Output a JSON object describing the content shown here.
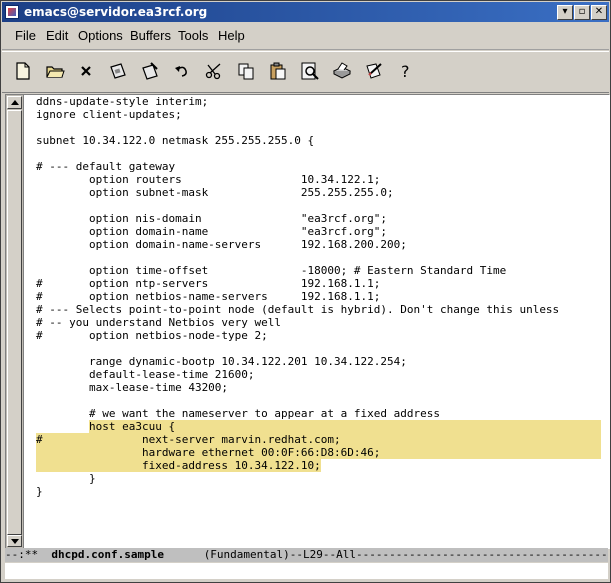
{
  "window": {
    "title": "emacs@servidor.ea3rcf.org",
    "buttons": [
      "▾",
      "▫",
      "✕"
    ]
  },
  "menu": [
    "File",
    "Edit",
    "Options",
    "Buffers",
    "Tools",
    "Help"
  ],
  "toolbar": [
    {
      "name": "new-file-icon"
    },
    {
      "name": "open-folder-icon"
    },
    {
      "name": "close-buffer-icon"
    },
    {
      "name": "save-icon"
    },
    {
      "name": "save-as-icon"
    },
    {
      "name": "undo-icon"
    },
    {
      "name": "cut-icon"
    },
    {
      "name": "copy-icon"
    },
    {
      "name": "paste-icon"
    },
    {
      "name": "search-icon"
    },
    {
      "name": "print-icon"
    },
    {
      "name": "preferences-icon"
    },
    {
      "name": "help-icon"
    }
  ],
  "buffer": {
    "lines": [
      "ddns-update-style interim;",
      "ignore client-updates;",
      "",
      "subnet 10.34.122.0 netmask 255.255.255.0 {",
      "",
      "# --- default gateway",
      "        option routers                  10.34.122.1;",
      "        option subnet-mask              255.255.255.0;",
      "",
      "        option nis-domain               \"ea3rcf.org\";",
      "        option domain-name              \"ea3rcf.org\";",
      "        option domain-name-servers      192.168.200.200;",
      "",
      "        option time-offset              -18000; # Eastern Standard Time",
      "#       option ntp-servers              192.168.1.1;",
      "#       option netbios-name-servers     192.168.1.1;",
      "# --- Selects point-to-point node (default is hybrid). Don't change this unless",
      "# -- you understand Netbios very well",
      "#       option netbios-node-type 2;",
      "",
      "        range dynamic-bootp 10.34.122.201 10.34.122.254;",
      "        default-lease-time 21600;",
      "        max-lease-time 43200;",
      "",
      "        # we want the nameserver to appear at a fixed address",
      "        host ea3cuu {",
      "#               next-server marvin.redhat.com;",
      "                hardware ethernet 00:0F:66:D8:6D:46;",
      "                fixed-address 10.34.122.10;",
      "        }",
      "}"
    ]
  },
  "modeline": {
    "prefix": "--:**  ",
    "buffer_name": "dhcpd.conf.sample",
    "suffix": "      (Fundamental)--L29--All-------------------------------------------"
  },
  "colors": {
    "region_highlight": "#f0e090",
    "titlebar": "#1c3f86"
  }
}
